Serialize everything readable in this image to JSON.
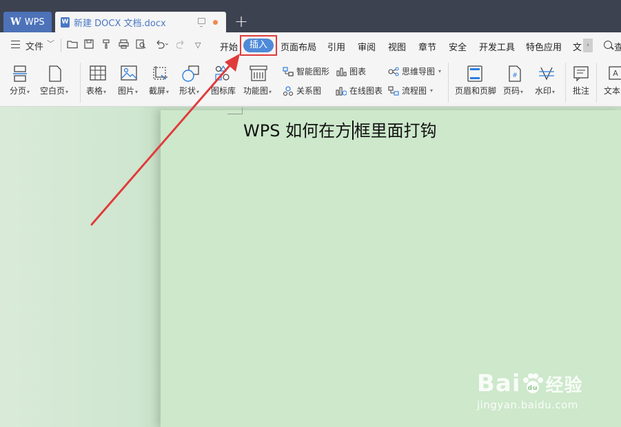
{
  "titlebar": {
    "wps_tab": "WPS",
    "doc_tab": "新建 DOCX 文档.docx",
    "new_tab": "+"
  },
  "menubar": {
    "file": "文件",
    "tabs": [
      "开始",
      "插入",
      "页面布局",
      "引用",
      "审阅",
      "视图",
      "章节",
      "安全",
      "开发工具",
      "特色应用",
      "文"
    ],
    "active_tab": "插入",
    "search_label": "查"
  },
  "ribbon": {
    "page_break": "分页",
    "blank_page": "空白页",
    "table": "表格",
    "picture": "图片",
    "screenshot": "截屏",
    "shape": "形状",
    "icon_library": "图标库",
    "function_chart": "功能图",
    "smart_art": "智能图形",
    "chart": "图表",
    "mind_map": "思维导图",
    "relation_chart": "关系图",
    "online_chart": "在线图表",
    "flow_chart": "流程图",
    "header_footer": "页眉和页脚",
    "page_number": "页码",
    "watermark": "水印",
    "comment": "批注",
    "text_box": "文本"
  },
  "document": {
    "text_before_cursor": "WPS 如何在方",
    "text_after_cursor": "框里面打钩"
  },
  "watermark_overlay": {
    "brand_left": "Bai",
    "brand_right": "经验",
    "url": "jingyan.baidu.com"
  },
  "colors": {
    "titlebar": "#3d4250",
    "active_tab_pill": "#4f8ad8",
    "highlight_box": "#e03b3b",
    "page_bg": "#cde8cb"
  }
}
